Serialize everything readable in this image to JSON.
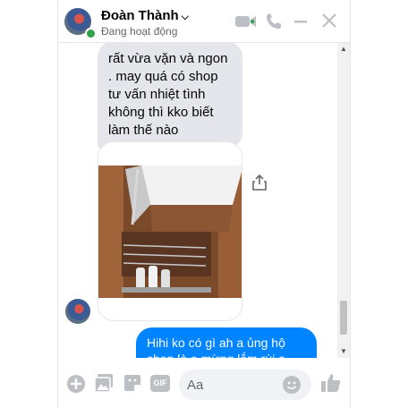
{
  "header": {
    "name": "Đoàn Thành",
    "status": "Đang hoạt động",
    "accent_color": "#bcc0c4",
    "icons": [
      "video-camera-icon",
      "phone-icon",
      "minimize-icon",
      "close-icon"
    ]
  },
  "messages": {
    "incoming_text": "rất vừa vặn và ngon . may quá có shop tư vấn nhiệt tình không thì kko biết làm thế nào",
    "outgoing_text": "Hihi ko có gì ah a ủng hộ shop là e mừng lắm rùi a",
    "outgoing_color": "#0084ff",
    "incoming_color": "#e4e6eb"
  },
  "composer": {
    "placeholder": "Aa",
    "icons": [
      "add-icon",
      "photo-icon",
      "sticker-icon",
      "gif-icon",
      "emoji-icon",
      "like-icon"
    ],
    "gif_label": "GIF"
  }
}
